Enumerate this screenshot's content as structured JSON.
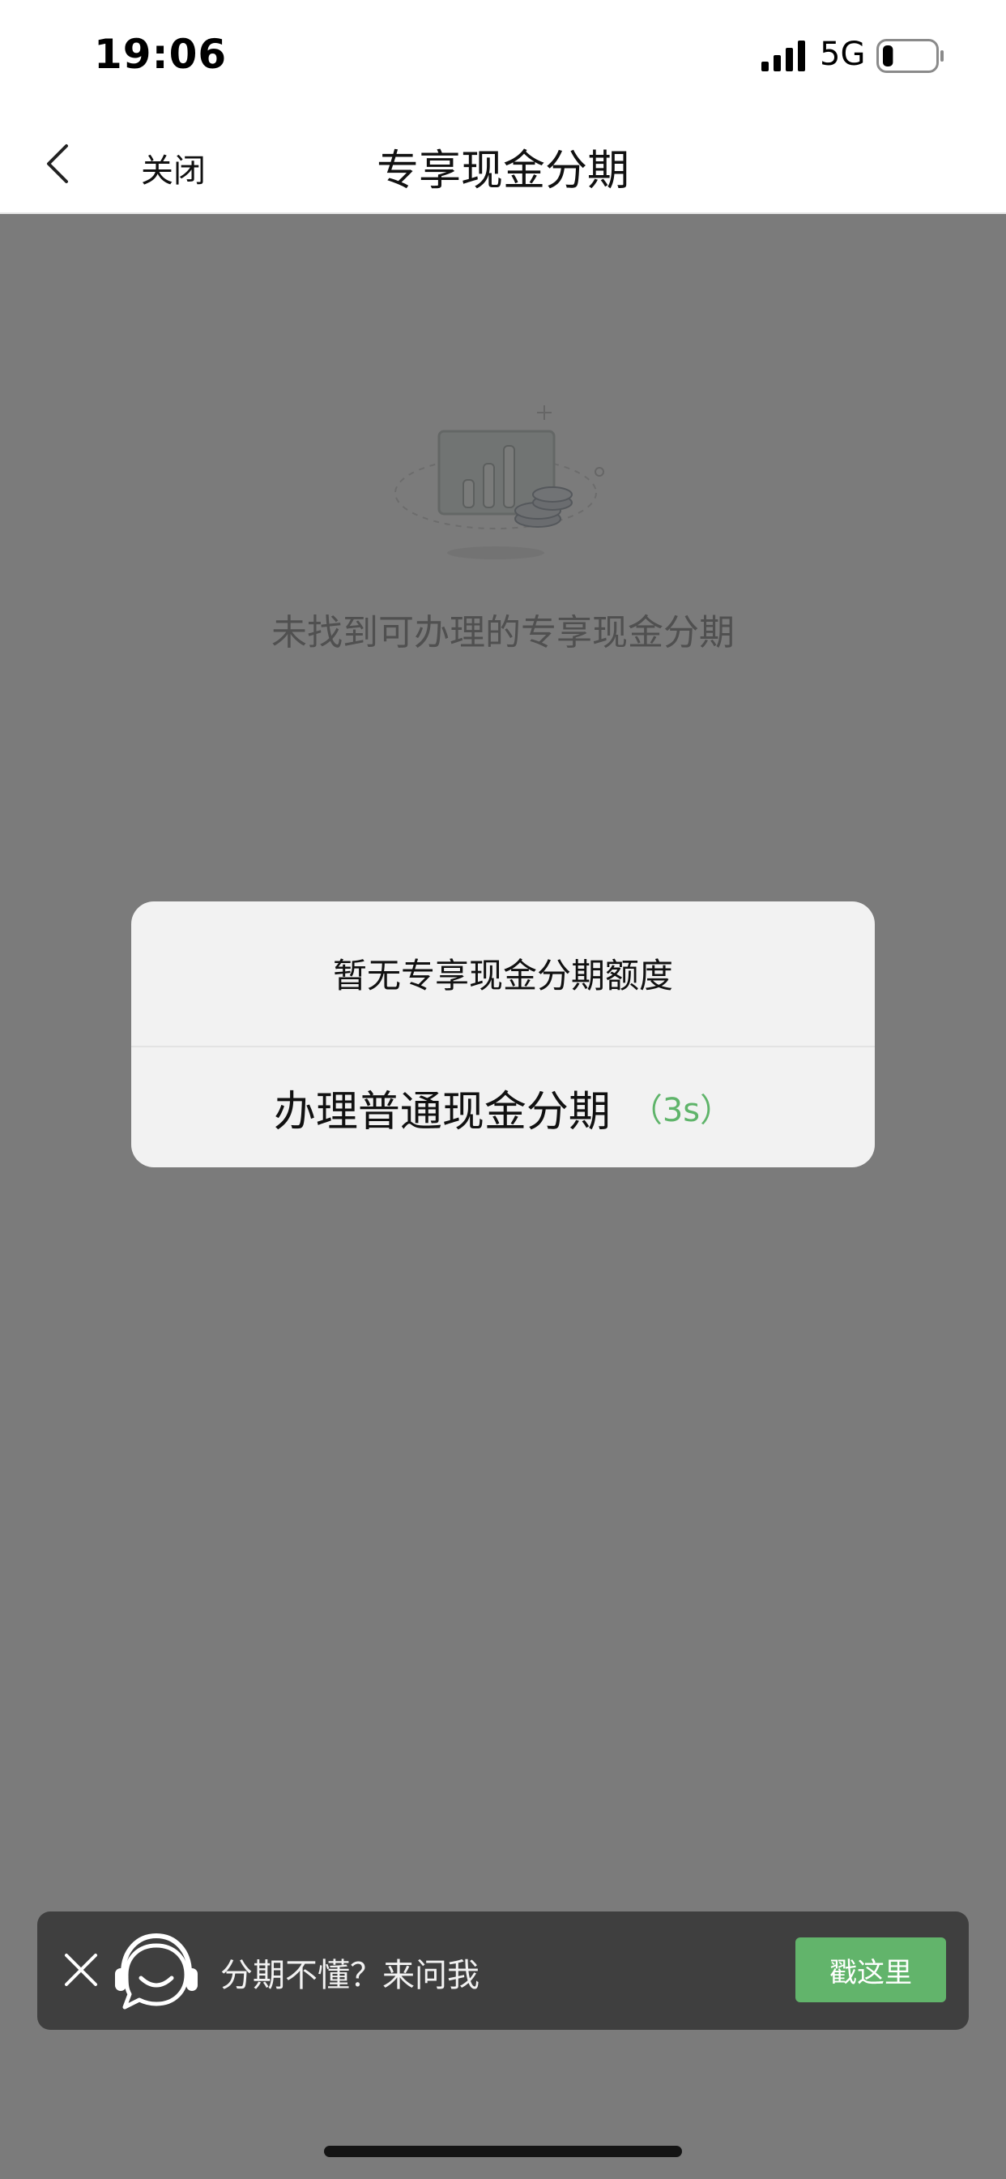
{
  "status_bar": {
    "time": "19:06",
    "network": "5G",
    "battery_level": 0.2
  },
  "nav": {
    "back_icon": "chevron-left-icon",
    "close_label": "关闭",
    "title": "专享现金分期"
  },
  "empty_state": {
    "illustration_icon": "chart-with-coins-icon",
    "message": "未找到可办理的专享现金分期"
  },
  "dialog": {
    "title": "暂无专享现金分期额度",
    "action_label": "办理普通现金分期",
    "countdown": "（3s）"
  },
  "help_banner": {
    "close_icon": "close-icon",
    "avatar_icon": "customer-service-icon",
    "text": "分期不懂？来问我",
    "button_label": "戳这里"
  },
  "colors": {
    "accent_green": "#62b46b",
    "countdown_green": "#5fb46a",
    "banner_bg": "#3f3f3f",
    "overlay": "rgba(0,0,0,0.5)"
  }
}
